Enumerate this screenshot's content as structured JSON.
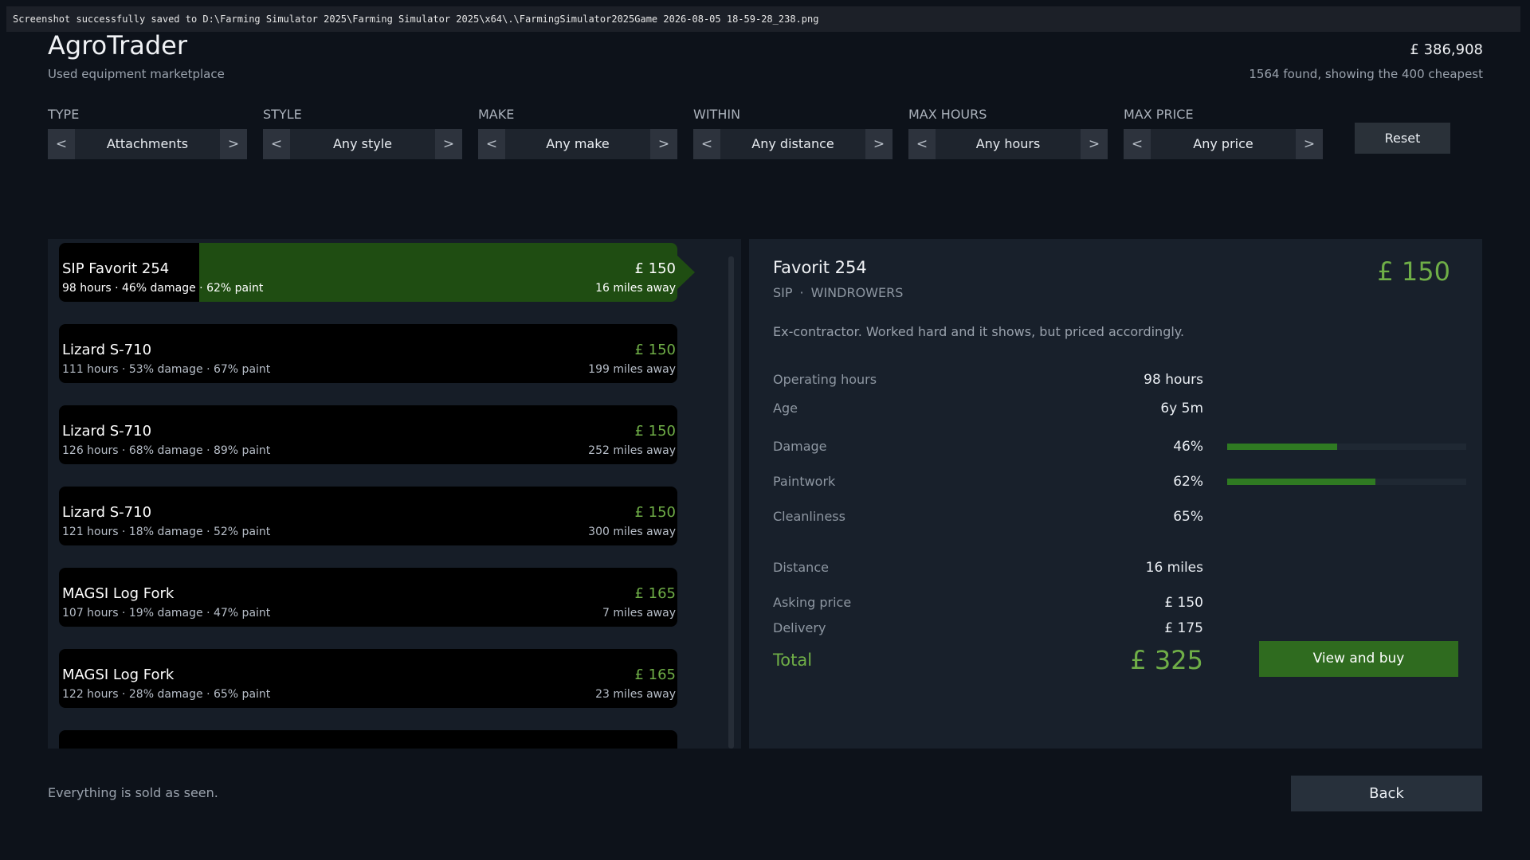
{
  "toast": "Screenshot successfully saved to D:\\Farming Simulator 2025\\Farming Simulator 2025\\x64\\.\\FarmingSimulator2025Game 2026-08-05 18-59-28_238.png",
  "header": {
    "title": "AgroTrader",
    "subtitle": "Used equipment marketplace",
    "balance": "£ 386,908",
    "found": "1564 found, showing the 400 cheapest"
  },
  "filters": [
    {
      "label": "TYPE",
      "value": "Attachments",
      "prev": "<",
      "next": ">"
    },
    {
      "label": "STYLE",
      "value": "Any style",
      "prev": "<",
      "next": ">"
    },
    {
      "label": "MAKE",
      "value": "Any make",
      "prev": "<",
      "next": ">"
    },
    {
      "label": "WITHIN",
      "value": "Any distance",
      "prev": "<",
      "next": ">"
    },
    {
      "label": "MAX HOURS",
      "value": "Any hours",
      "prev": "<",
      "next": ">"
    },
    {
      "label": "MAX PRICE",
      "value": "Any price",
      "prev": "<",
      "next": ">"
    }
  ],
  "reset_label": "Reset",
  "listings": [
    {
      "name": "SIP Favorit 254",
      "stats": "98 hours · 46% damage · 62% paint",
      "price": "£ 150",
      "distance": "16 miles away",
      "selected": true
    },
    {
      "name": "Lizard S-710",
      "stats": "111 hours · 53% damage · 67% paint",
      "price": "£ 150",
      "distance": "199 miles away"
    },
    {
      "name": "Lizard S-710",
      "stats": "126 hours · 68% damage · 89% paint",
      "price": "£ 150",
      "distance": "252 miles away"
    },
    {
      "name": "Lizard S-710",
      "stats": "121 hours · 18% damage · 52% paint",
      "price": "£ 150",
      "distance": "300 miles away"
    },
    {
      "name": "MAGSI Log Fork",
      "stats": "107 hours · 19% damage · 47% paint",
      "price": "£ 165",
      "distance": "7 miles away"
    },
    {
      "name": "MAGSI Log Fork",
      "stats": "122 hours · 28% damage · 65% paint",
      "price": "£ 165",
      "distance": "23 miles away"
    },
    {
      "name": "",
      "stats": "",
      "price": "",
      "distance": ""
    }
  ],
  "detail": {
    "name": "Favorit 254",
    "brand": "SIP",
    "separator": "·",
    "category": "WINDROWERS",
    "price": "£ 150",
    "description": "Ex-contractor. Worked hard and it shows, but priced accordingly.",
    "operating_hours_label": "Operating hours",
    "operating_hours": "98 hours",
    "age_label": "Age",
    "age": "6y 5m",
    "damage_label": "Damage",
    "damage": "46%",
    "damage_level": 0.46,
    "paint_label": "Paintwork",
    "paint": "62%",
    "paint_level": 0.62,
    "clean_label": "Cleanliness",
    "clean": "65%",
    "distance_label": "Distance",
    "distance": "16 miles",
    "asking_label": "Asking price",
    "asking": "£ 150",
    "delivery_label": "Delivery",
    "delivery": "£ 175",
    "total_label": "Total",
    "total": "£ 325",
    "buy_label": "View and buy"
  },
  "footer": {
    "note": "Everything is sold as seen.",
    "back_label": "Back"
  },
  "colors": {
    "accent_green": "#6fae47",
    "selected_bg": "#1f4d12",
    "button_green": "#2f6b1f",
    "background": "#0d121a"
  }
}
